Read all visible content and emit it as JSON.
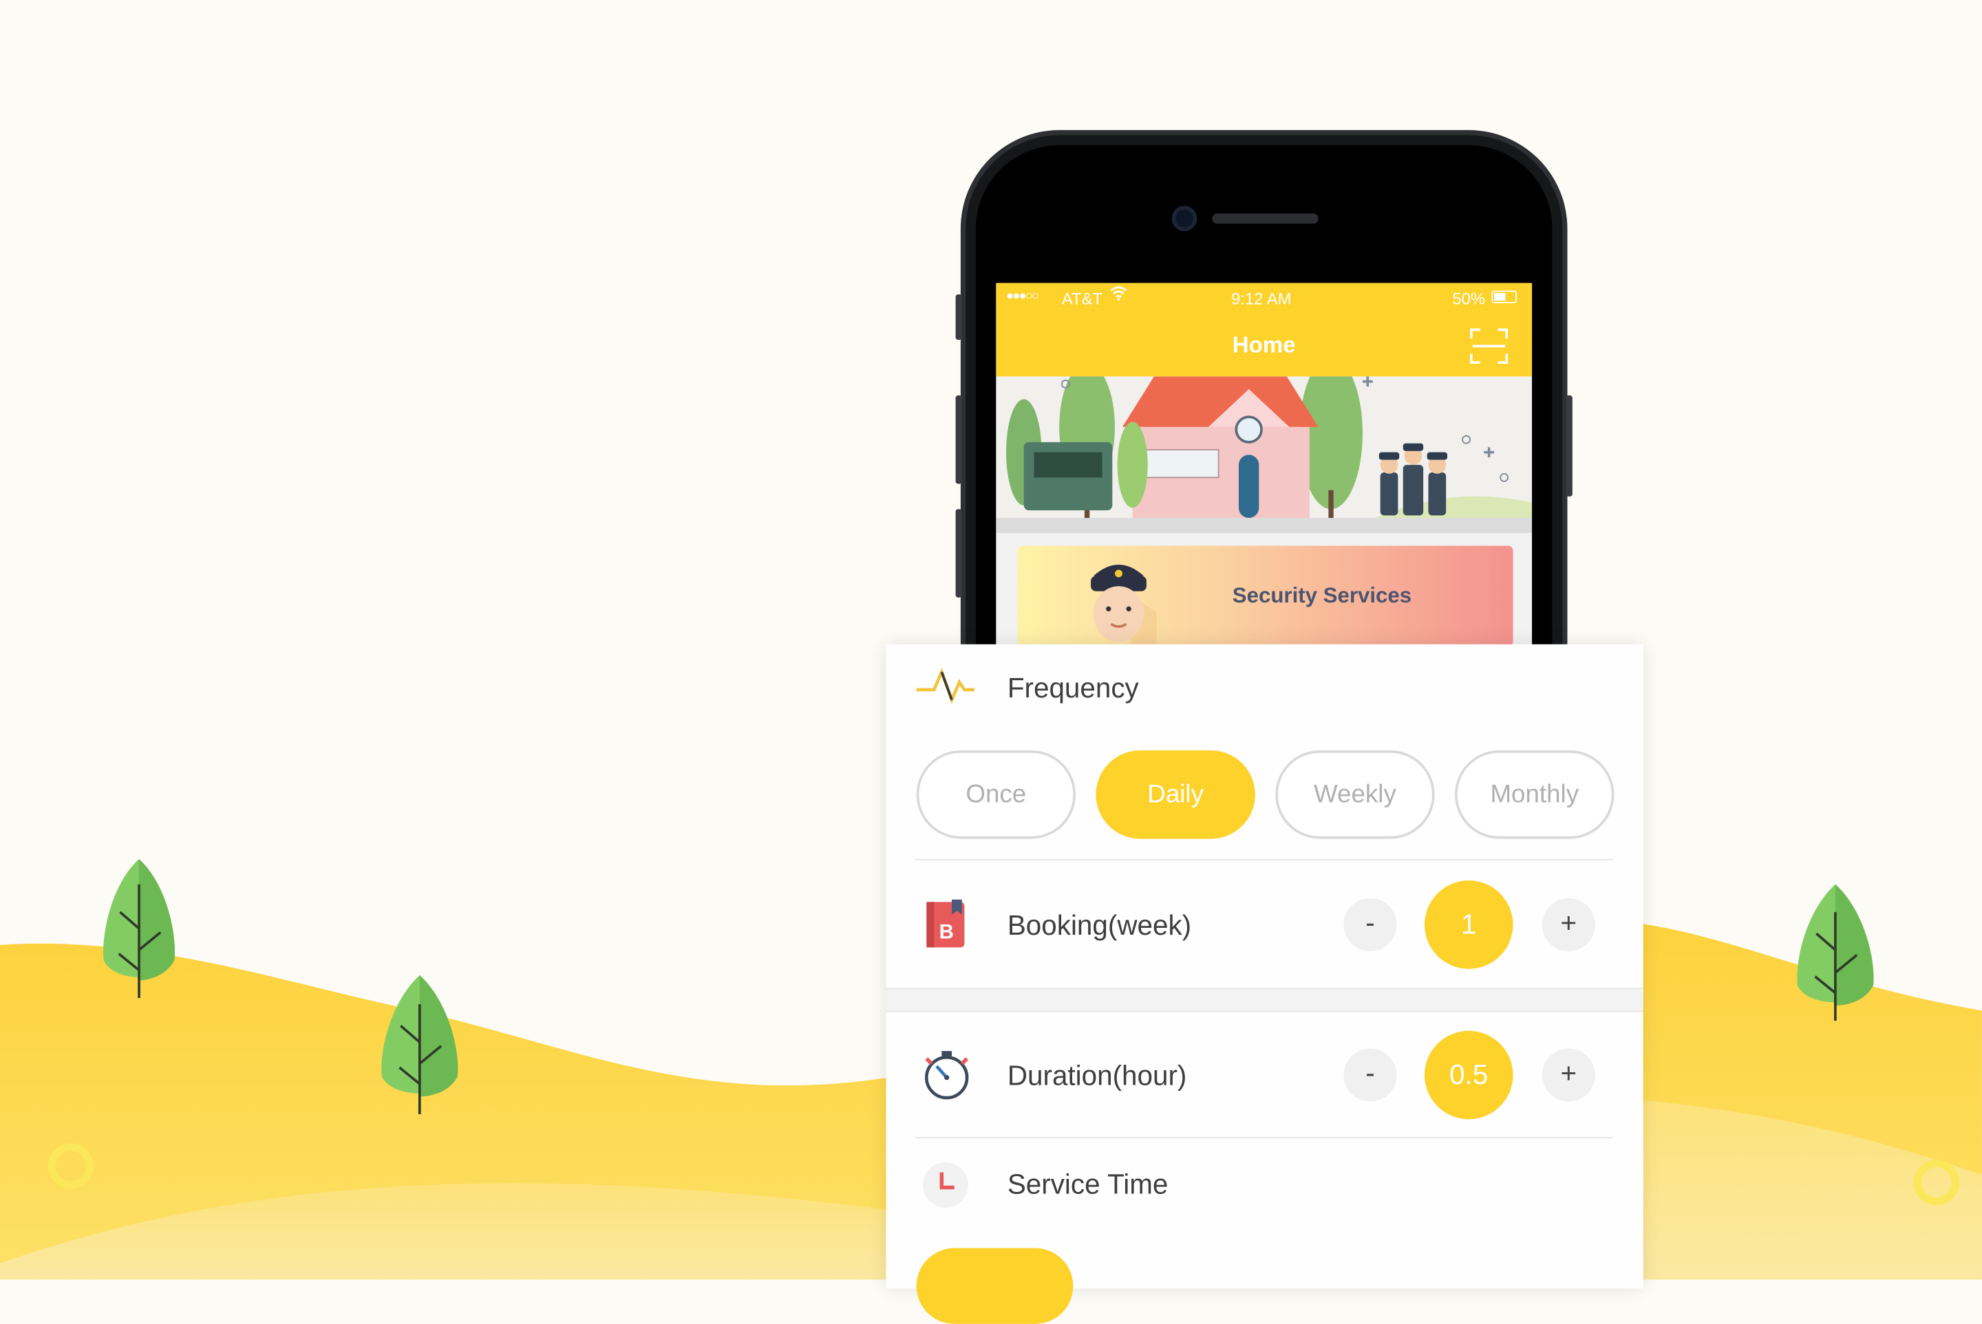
{
  "status_bar": {
    "carrier": "AT&T",
    "time": "9:12 AM",
    "battery": "50%"
  },
  "nav": {
    "title": "Home",
    "right_icon": "scan-icon"
  },
  "service_card": {
    "label": "Security Services"
  },
  "frequency": {
    "label": "Frequency",
    "icon": "pulse-icon",
    "options": [
      "Once",
      "Daily",
      "Weekly",
      "Monthly"
    ],
    "selected": "Daily"
  },
  "booking": {
    "label": "Booking(week)",
    "minus": "-",
    "value": "1",
    "plus": "+",
    "icon": "book-icon"
  },
  "duration": {
    "label": "Duration(hour)",
    "minus": "-",
    "value": "0.5",
    "plus": "+",
    "icon": "stopwatch-icon"
  },
  "service_time": {
    "label": "Service Time",
    "icon": "clock-icon"
  },
  "colors": {
    "accent": "#fdd22b",
    "hill": "#fdd84a",
    "tree": "#7fc863"
  }
}
